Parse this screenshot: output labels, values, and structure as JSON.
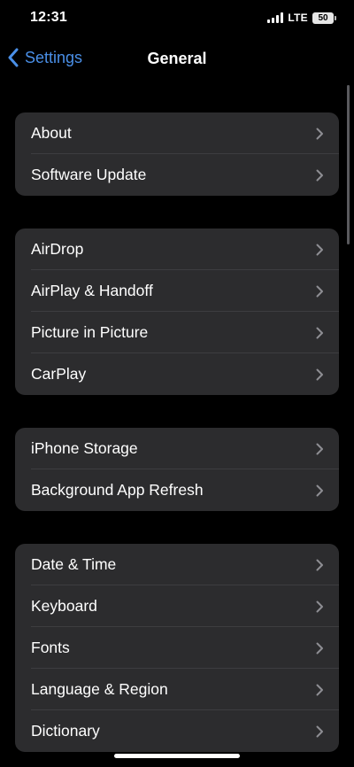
{
  "status_bar": {
    "time": "12:31",
    "network": "LTE",
    "battery": "50"
  },
  "nav": {
    "back_label": "Settings",
    "title": "General"
  },
  "groups": [
    {
      "items": [
        {
          "label": "About"
        },
        {
          "label": "Software Update"
        }
      ]
    },
    {
      "items": [
        {
          "label": "AirDrop"
        },
        {
          "label": "AirPlay & Handoff"
        },
        {
          "label": "Picture in Picture"
        },
        {
          "label": "CarPlay"
        }
      ]
    },
    {
      "items": [
        {
          "label": "iPhone Storage"
        },
        {
          "label": "Background App Refresh"
        }
      ]
    },
    {
      "items": [
        {
          "label": "Date & Time"
        },
        {
          "label": "Keyboard"
        },
        {
          "label": "Fonts"
        },
        {
          "label": "Language & Region"
        },
        {
          "label": "Dictionary"
        }
      ]
    }
  ],
  "colors": {
    "accent": "#4a8fe7",
    "group_bg": "#2c2c2e",
    "background": "#000000"
  },
  "icons": {
    "row_chevron": "chevron-right-icon",
    "back": "chevron-left-icon"
  }
}
